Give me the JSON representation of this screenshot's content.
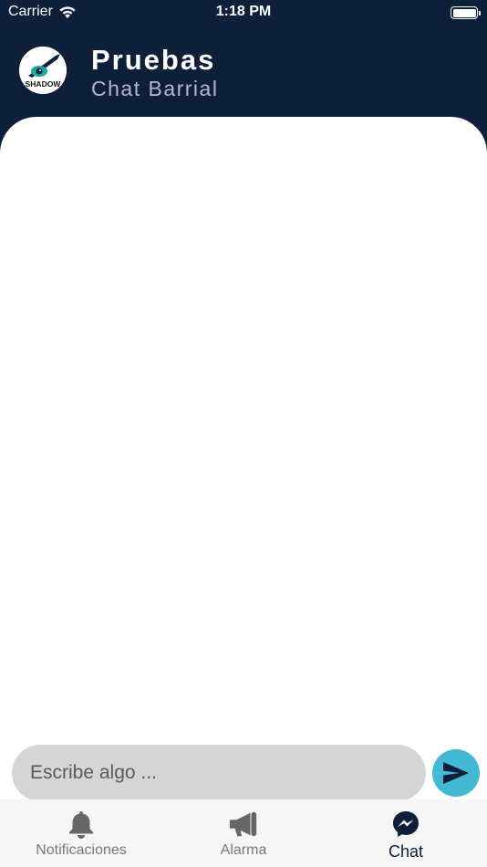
{
  "status_bar": {
    "carrier": "Carrier",
    "time": "1:18 PM",
    "battery_level": 1.0
  },
  "header": {
    "title": "Pruebas",
    "subtitle": "Chat Barrial",
    "avatar_text": "SHADOW"
  },
  "composer": {
    "placeholder": "Escribe algo ...",
    "value": ""
  },
  "tabs": [
    {
      "label": "Notificaciones",
      "icon": "bell-icon",
      "active": false
    },
    {
      "label": "Alarma",
      "icon": "megaphone-icon",
      "active": false
    },
    {
      "label": "Chat",
      "icon": "messenger-icon",
      "active": true
    }
  ],
  "colors": {
    "header_bg": "#0e1f3a",
    "subtitle": "#b8b4d8",
    "send_button": "#44b9d6",
    "input_bg": "#d6d6d6",
    "tabbar_bg": "#f6f6f6"
  }
}
